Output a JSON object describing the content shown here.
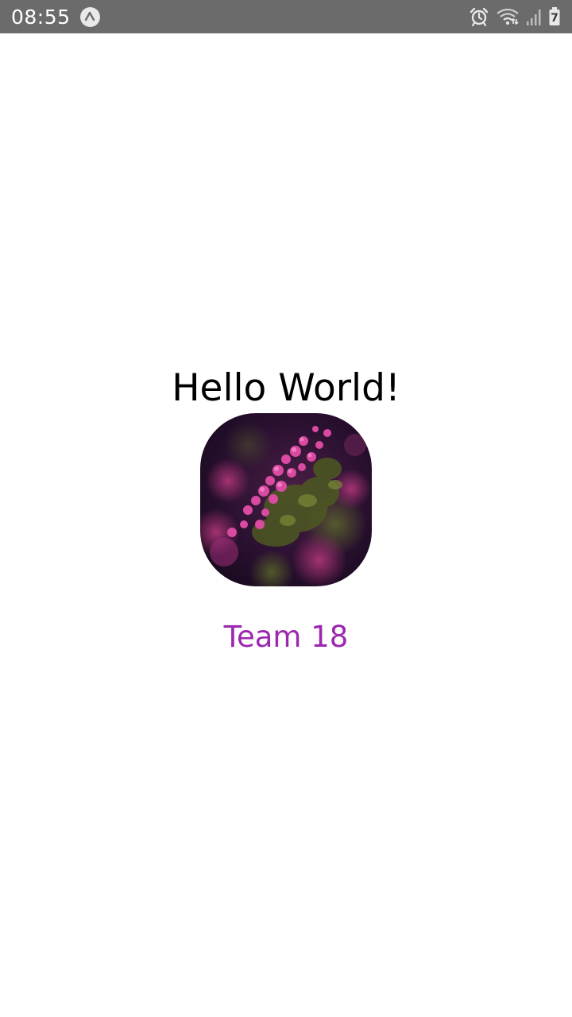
{
  "status_bar": {
    "time": "08:55",
    "app_icon": "expo-caret-icon",
    "right_icons": [
      "alarm-icon",
      "wifi-icon",
      "signal-icon",
      "battery-icon"
    ],
    "battery_level": "7"
  },
  "main": {
    "title": "Hello World!",
    "image": {
      "subject": "pink-flowers-photo"
    },
    "team_label": "Team 18",
    "team_label_color": "#9c27b0"
  }
}
